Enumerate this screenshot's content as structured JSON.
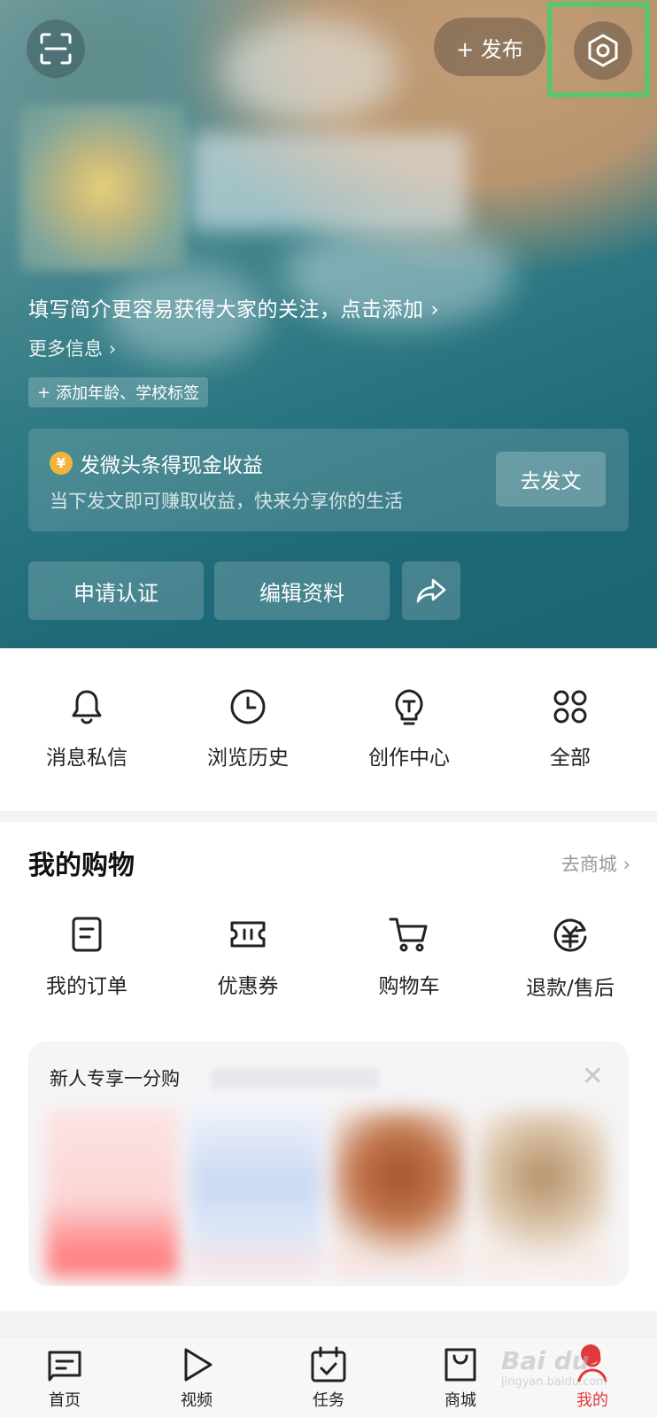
{
  "header": {
    "publish_label": "+ 发布",
    "bio_prompt": "填写简介更容易获得大家的关注，点击添加",
    "more_info": "更多信息",
    "add_tags": "添加年龄、学校标签"
  },
  "promo": {
    "coin_symbol": "¥",
    "title": "发微头条得现金收益",
    "subtitle": "当下发文即可赚取收益，快来分享你的生活",
    "button": "去发文"
  },
  "actions": {
    "verify": "申请认证",
    "edit_profile": "编辑资料"
  },
  "quick_links": [
    {
      "label": "消息私信",
      "icon": "bell-icon"
    },
    {
      "label": "浏览历史",
      "icon": "clock-icon"
    },
    {
      "label": "创作中心",
      "icon": "bulb-icon"
    },
    {
      "label": "全部",
      "icon": "grid-icon"
    }
  ],
  "shopping": {
    "title": "我的购物",
    "link": "去商城",
    "items": [
      {
        "label": "我的订单",
        "icon": "order-icon"
      },
      {
        "label": "优惠券",
        "icon": "coupon-icon"
      },
      {
        "label": "购物车",
        "icon": "cart-icon"
      },
      {
        "label": "退款/售后",
        "icon": "refund-icon"
      }
    ],
    "card_title": "新人专享一分购"
  },
  "tabs": [
    {
      "label": "首页",
      "icon": "home-icon"
    },
    {
      "label": "视频",
      "icon": "play-icon"
    },
    {
      "label": "任务",
      "icon": "calendar-icon"
    },
    {
      "label": "商城",
      "icon": "shopping-bag-icon"
    },
    {
      "label": "我的",
      "icon": "profile-icon"
    }
  ],
  "watermark": {
    "text": "Bai du",
    "sub": "jingyan.baidu.com"
  },
  "colors": {
    "accent": "#e23a3a",
    "highlight": "#5cc46a"
  }
}
